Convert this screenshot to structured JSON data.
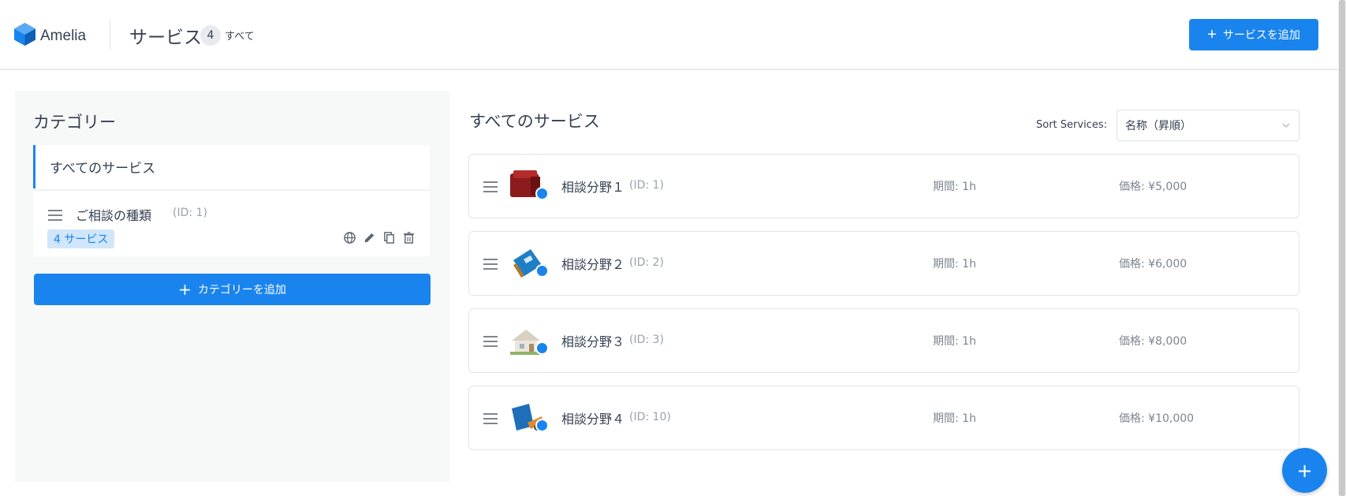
{
  "header": {
    "logo_text": "Amelia",
    "page_title": "サービス",
    "count": "4",
    "count_label": "すべて",
    "add_service_label": "サービスを追加"
  },
  "categories": {
    "title": "カテゴリー",
    "all_services_label": "すべてのサービス",
    "items": [
      {
        "name": "ご相談の種類",
        "id_label": "(ID: 1)",
        "badge": "4 サービス"
      }
    ],
    "add_category_label": "カテゴリーを追加"
  },
  "services": {
    "title": "すべてのサービス",
    "sort_label": "Sort Services:",
    "sort_value": "名称（昇順）",
    "items": [
      {
        "name": "相談分野１",
        "id_label": "(ID: 1)",
        "duration": "期間: 1h",
        "price": "価格: ¥5,000",
        "thumb": "folder-red"
      },
      {
        "name": "相談分野２",
        "id_label": "(ID: 2)",
        "duration": "期間: 1h",
        "price": "価格: ¥6,000",
        "thumb": "book-blue"
      },
      {
        "name": "相談分野３",
        "id_label": "(ID: 3)",
        "duration": "期間: 1h",
        "price": "価格: ¥8,000",
        "thumb": "house"
      },
      {
        "name": "相談分野４",
        "id_label": "(ID: 10)",
        "duration": "期間: 1h",
        "price": "価格: ¥10,000",
        "thumb": "pen-blue"
      }
    ]
  },
  "colors": {
    "accent": "#1a84ee",
    "badge_bg": "#cfe6fb",
    "panel_bg": "#f7f8f8"
  }
}
